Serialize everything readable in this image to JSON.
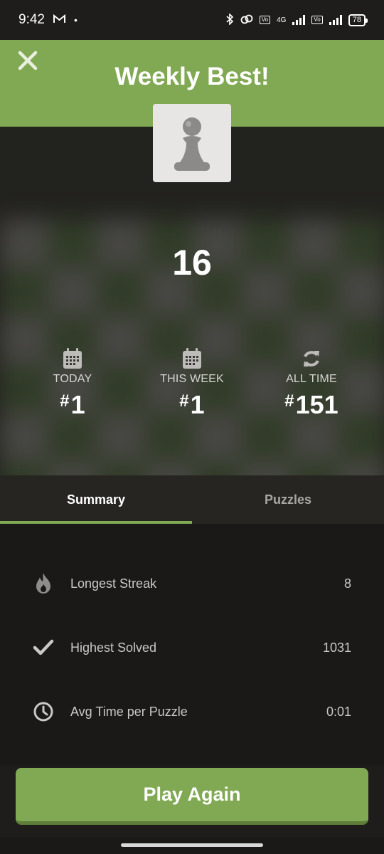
{
  "status_bar": {
    "time": "9:42",
    "network": "4G",
    "battery": "78"
  },
  "header": {
    "title": "Weekly Best!"
  },
  "score": "16",
  "ranks": [
    {
      "label": "TODAY",
      "hash": "#",
      "value": "1",
      "icon": "calendar-icon"
    },
    {
      "label": "THIS WEEK",
      "hash": "#",
      "value": "1",
      "icon": "calendar-icon"
    },
    {
      "label": "ALL TIME",
      "hash": "#",
      "value": "151",
      "icon": "refresh-icon"
    }
  ],
  "tabs": {
    "summary": "Summary",
    "puzzles": "Puzzles"
  },
  "stats": [
    {
      "label": "Longest Streak",
      "value": "8",
      "icon": "flame-icon"
    },
    {
      "label": "Highest Solved",
      "value": "1031",
      "icon": "checkmark-icon"
    },
    {
      "label": "Avg Time per Puzzle",
      "value": "0:01",
      "icon": "clock-icon"
    }
  ],
  "play_button": "Play Again",
  "colors": {
    "accent": "#81a853",
    "background": "#1e1d1b"
  }
}
